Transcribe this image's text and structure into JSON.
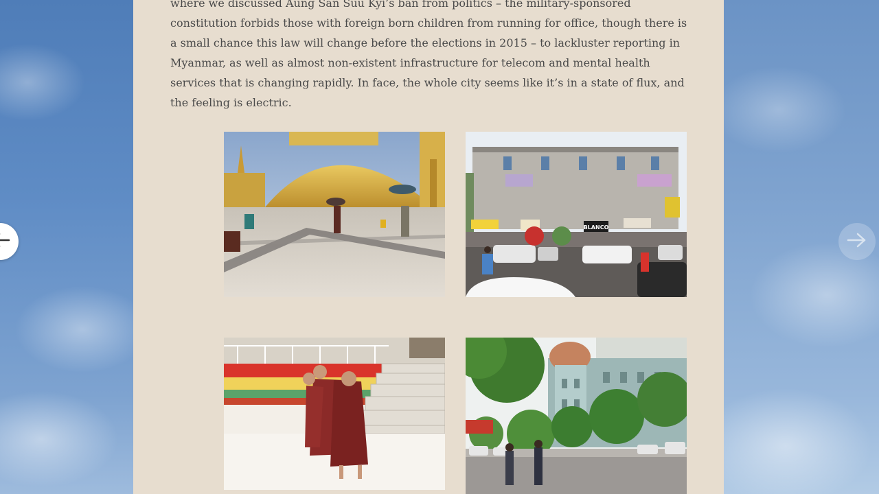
{
  "article": {
    "paragraph": "where we discussed Aung San Suu Kyi’s ban from politics – the military-sponsored constitution forbids those with foreign born children from running for office, though there is a small chance this law will change before the elections in 2015 – to lackluster reporting in Myanmar, as well as almost non-existent infrastructure for telecom and mental health services that is changing rapidly. In face, the whole city seems like it’s in a state of flux, and the feeling is electric.",
    "photos": [
      {
        "icon": "shwedagon-pagoda-photo"
      },
      {
        "icon": "street-building-photo",
        "sign_text": "BLANCO"
      },
      {
        "icon": "novice-monks-photo"
      },
      {
        "icon": "colonial-building-street-photo"
      }
    ]
  },
  "navigation": {
    "prev_icon": "arrow-left-icon",
    "next_icon": "arrow-right-icon"
  },
  "colors": {
    "page_background": "#e7ddcf",
    "body_text": "#4a4a4a",
    "sky": "#6f97c8"
  }
}
